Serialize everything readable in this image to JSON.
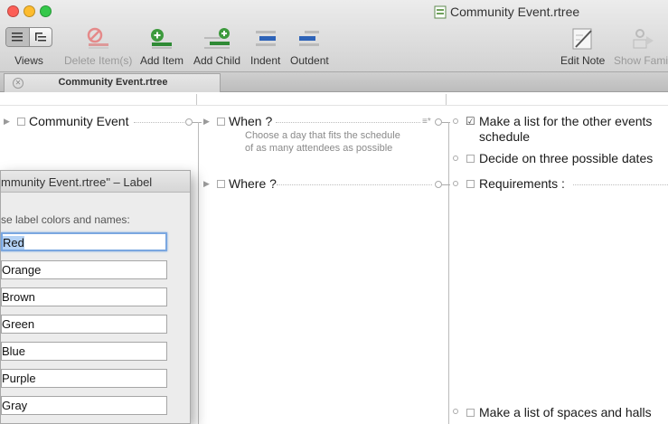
{
  "window": {
    "title": "Community Event.rtree",
    "traffic_lights": {
      "close": "#fc5f57",
      "minimize": "#fdbc2e",
      "zoom": "#34c84a"
    }
  },
  "toolbar": {
    "views": "Views",
    "delete_items": "Delete Item(s)",
    "add_item": "Add Item",
    "add_child": "Add Child",
    "indent": "Indent",
    "outdent": "Outdent",
    "edit_note": "Edit Note",
    "show_family": "Show Famil"
  },
  "tab": {
    "label": "Community Event.rtree"
  },
  "outline": {
    "root": "Community Event",
    "when": {
      "label": "When ?",
      "note_line1": "Choose a day that fits the schedule",
      "note_line2": "of as many attendees as possible"
    },
    "where": {
      "label": "Where ?"
    },
    "when_children": [
      {
        "line1": "Make a list for the other events",
        "line2": "schedule",
        "checked": true
      },
      {
        "line1": "Decide on three possible dates",
        "checked": false
      }
    ],
    "where_children": [
      {
        "label": "Requirements :",
        "checked": false
      },
      {
        "label": "Make a list of spaces and halls",
        "checked": false
      }
    ]
  },
  "label_panel": {
    "title": "mmunity Event.rtree\" – Label",
    "prompt": "se label colors and names:",
    "labels": [
      "Red",
      "Orange",
      "Brown",
      "Green",
      "Blue",
      "Purple",
      "Gray"
    ]
  }
}
